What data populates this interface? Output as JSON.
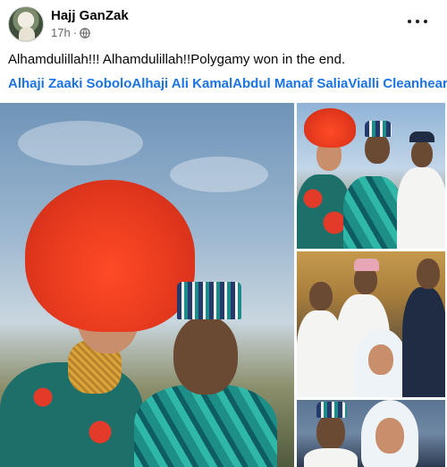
{
  "post": {
    "author": "Hajj GanZak",
    "time": "17h",
    "separator": "·",
    "text": "Alhamdulillah!!! Alhamdulillah!!Polygamy won in the end.",
    "tags": [
      "Alhaji Zaaki Sobolo",
      "Alhaji Ali Kamal",
      "Abdul Manaf Salia",
      "Vialli Cleanheart"
    ]
  },
  "icons": {
    "privacy": "globe-icon",
    "menu": "more-options-icon"
  },
  "colors": {
    "link": "#1b74e4",
    "meta": "#65676b",
    "text": "#050505"
  }
}
